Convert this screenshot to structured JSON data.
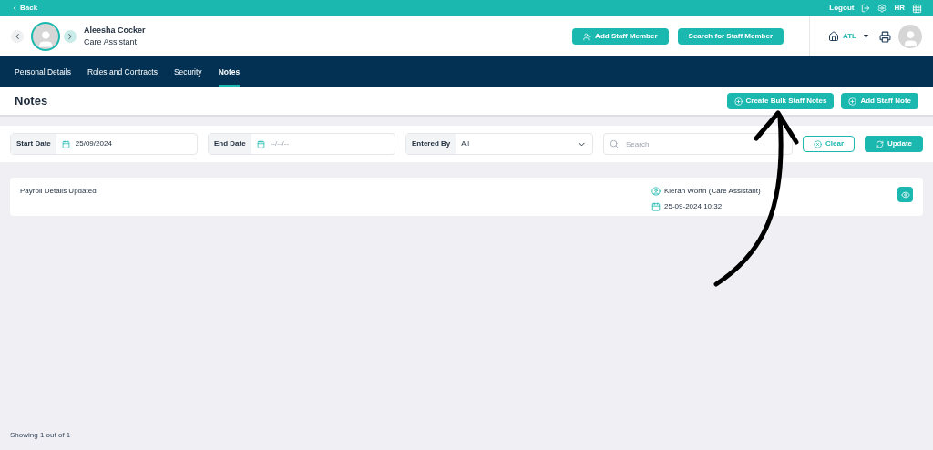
{
  "top_bar": {
    "back": "Back",
    "logout": "Logout",
    "user_initials": "HR"
  },
  "header": {
    "name": "Aleesha Cocker",
    "role": "Care Assistant",
    "buttons": [
      "Add Staff Member",
      "Search for Staff Member"
    ],
    "location": "ATL"
  },
  "tabs": [
    {
      "label": "Personal Details",
      "selected": false
    },
    {
      "label": "Roles and Contracts",
      "selected": false
    },
    {
      "label": "Security",
      "selected": false
    },
    {
      "label": "Notes",
      "selected": true
    }
  ],
  "page": {
    "title": "Notes",
    "actions": [
      "Create Bulk Staff Notes",
      "Add Staff Note"
    ]
  },
  "filters": {
    "start_date": {
      "label": "Start Date",
      "value": "25/09/2024"
    },
    "end_date": {
      "label": "End Date",
      "placeholder": "--/--/--"
    },
    "entered_by": {
      "label": "Entered By",
      "value": "All"
    },
    "search": {
      "placeholder": "Search"
    },
    "clear": "Clear",
    "update": "Update"
  },
  "notes": [
    {
      "title": "Payroll Details Updated",
      "author": "Kieran Worth (Care Assistant)",
      "date": "25-09-2024 10:32"
    }
  ],
  "footer": "Showing 1 out of 1"
}
